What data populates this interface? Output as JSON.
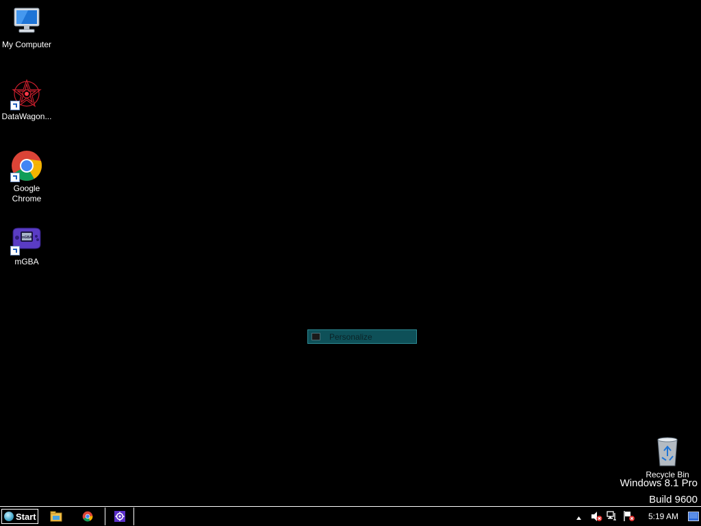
{
  "desktop": {
    "icons": [
      {
        "label": "My Computer",
        "icon": "computer-icon"
      },
      {
        "label": "DataWagon...",
        "icon": "datawagon-icon"
      },
      {
        "label": "Google Chrome",
        "icon": "chrome-icon"
      },
      {
        "label": "mGBA",
        "icon": "gba-icon"
      }
    ],
    "recycle_bin": {
      "label": "Recycle Bin",
      "icon": "recycle-bin-icon"
    }
  },
  "context_menu": {
    "items": [
      {
        "label": "Personalize",
        "icon": "display-icon"
      }
    ]
  },
  "watermark": {
    "line1": "Windows 8.1 Pro",
    "line2": "Build 9600"
  },
  "taskbar": {
    "start_label": "Start",
    "pinned": [
      {
        "icon": "file-explorer-icon"
      },
      {
        "icon": "chrome-icon"
      },
      {
        "icon": "settings-gear-icon"
      }
    ],
    "tray": {
      "overflow_icon": "chevron-up-icon",
      "icons": [
        "speaker-muted-icon",
        "network-icon",
        "action-center-flag-icon"
      ],
      "clock": "5:19 AM",
      "show_desktop_icon": "show-desktop-icon"
    }
  },
  "colors": {
    "desktop_bg": "#000000",
    "menu_highlight": "#0e5058",
    "taskbar_bg": "#000000"
  }
}
